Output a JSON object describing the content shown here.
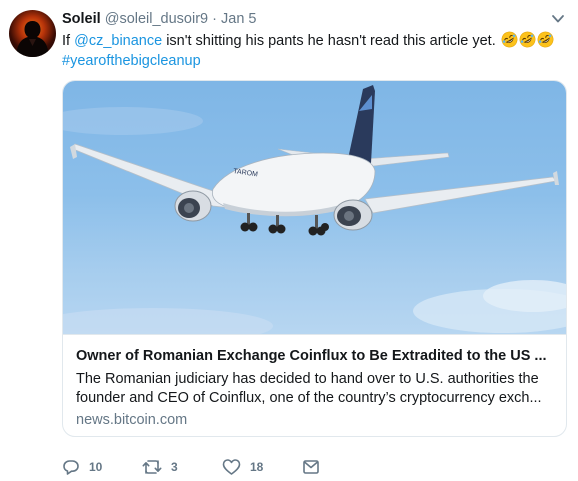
{
  "tweet": {
    "author_name": "Soleil",
    "author_handle": "@soleil_dusoir9",
    "separator": "·",
    "date": "Jan 5",
    "text_prefix": "If ",
    "mention": "@cz_binance",
    "text_body": " isn't shitting his pants he hasn't read this article yet.",
    "emojis": [
      "rolling-on-floor-laughing-emoji",
      "rolling-on-floor-laughing-emoji",
      "rolling-on-floor-laughing-emoji"
    ],
    "hashtag": "#yearofthebigcleanup"
  },
  "card": {
    "image_icon": "airplane-photo",
    "title": "Owner of Romanian Exchange Coinflux to Be Extradited to the US ...",
    "description": "The Romanian judiciary has decided to hand over to U.S. authorities the founder and CEO of Coinflux, one of the country’s cryptocurrency exch...",
    "domain": "news.bitcoin.com"
  },
  "actions": {
    "reply": {
      "icon": "reply-icon",
      "count": "10"
    },
    "retweet": {
      "icon": "retweet-icon",
      "count": "3"
    },
    "like": {
      "icon": "heart-icon",
      "count": "18"
    },
    "message": {
      "icon": "envelope-icon"
    }
  },
  "colors": {
    "link": "#1b95e0",
    "secondary_text": "#657786",
    "primary_text": "#14171a",
    "border": "#e1e8ed"
  }
}
